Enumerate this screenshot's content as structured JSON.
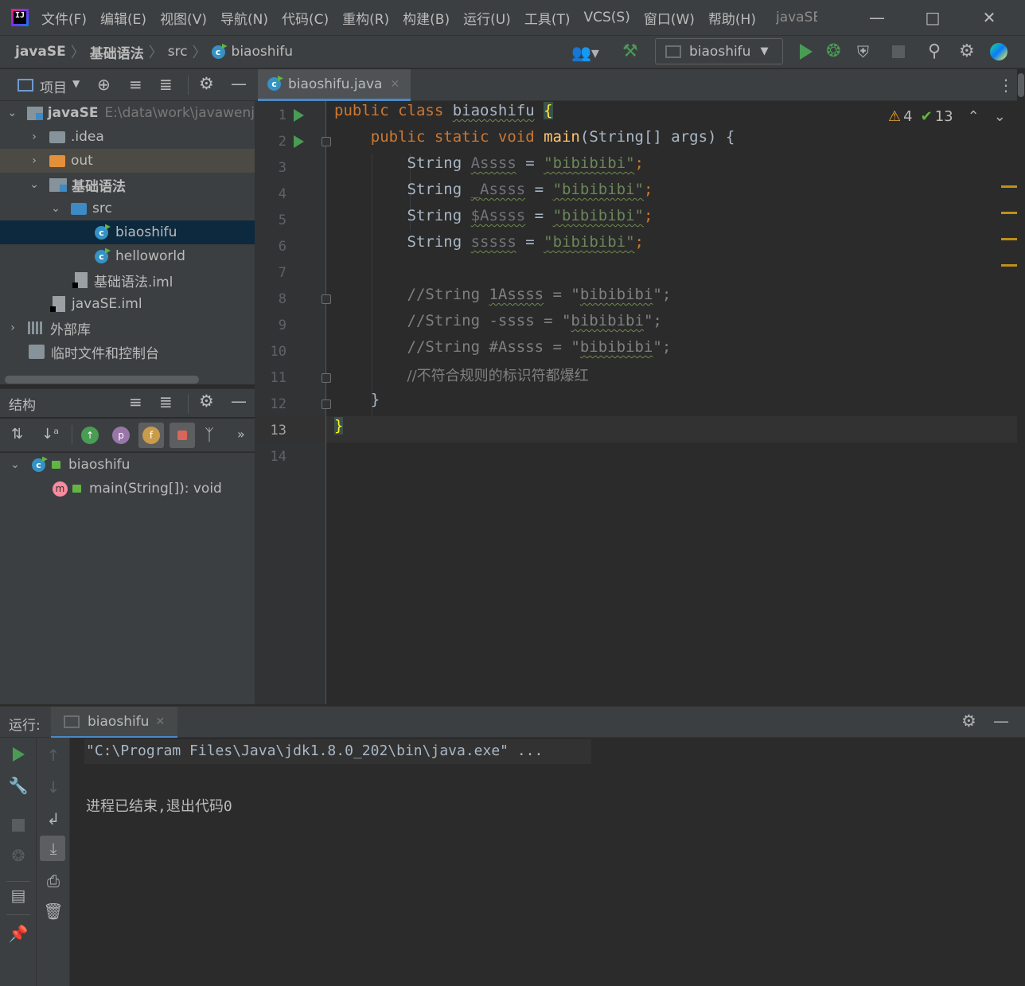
{
  "menu": {
    "items": [
      "文件(F)",
      "编辑(E)",
      "视图(V)",
      "导航(N)",
      "代码(C)",
      "重构(R)",
      "构建(B)",
      "运行(U)",
      "工具(T)",
      "VCS(S)",
      "窗口(W)",
      "帮助(H)"
    ],
    "window_title": "javaSE"
  },
  "breadcrumb": {
    "project": "javaSE",
    "module": "基础语法",
    "folder": "src",
    "file": "biaoshifu"
  },
  "toolbar": {
    "run_config": "biaoshifu"
  },
  "project_panel": {
    "title": "项目",
    "tree": [
      {
        "label": "javaSE",
        "path": "E:\\data\\work\\javawenj"
      },
      {
        "label": ".idea"
      },
      {
        "label": "out"
      },
      {
        "label": "基础语法"
      },
      {
        "label": "src"
      },
      {
        "label": "biaoshifu"
      },
      {
        "label": "helloworld"
      },
      {
        "label": "基础语法.iml"
      },
      {
        "label": "javaSE.iml"
      },
      {
        "label": "外部库"
      },
      {
        "label": "临时文件和控制台"
      }
    ]
  },
  "structure_panel": {
    "title": "结构",
    "class_name": "biaoshifu",
    "method": "main(String[]): void"
  },
  "editor": {
    "tab_label": "biaoshifu.java",
    "warnings": "4",
    "checks": "13",
    "line_numbers": [
      "1",
      "2",
      "3",
      "4",
      "5",
      "6",
      "7",
      "8",
      "9",
      "10",
      "11",
      "12",
      "13",
      "14"
    ],
    "code": {
      "l1_kw": "public class ",
      "l1_name": "biaoshifu",
      "l1_brace": "{",
      "l2_kw": "public static void ",
      "l2_fn": "main",
      "l2_rest": "(String[] args) {",
      "l3_type": "String ",
      "l3_var": "Assss",
      "l3_eq": " = ",
      "l3_str": "\"bibibibi\"",
      "l3_end": ";",
      "l4_type": "String ",
      "l4_var": "_Assss",
      "l4_eq": " = ",
      "l4_str": "\"bibibibi\"",
      "l4_end": ";",
      "l5_type": "String ",
      "l5_var": "$Assss",
      "l5_eq": " = ",
      "l5_str": "\"bibibibi\"",
      "l5_end": ";",
      "l6_type": "String ",
      "l6_var": "sssss",
      "l6_eq": " = ",
      "l6_str": "\"bibibibi\"",
      "l6_end": ";",
      "l8_a": "//String ",
      "l8_b": "1Assss",
      "l8_c": " = \"",
      "l8_d": "bibibibi",
      "l8_e": "\";",
      "l9_a": "//String -ssss = \"",
      "l9_d": "bibibibi",
      "l9_e": "\";",
      "l10_a": "//String #Assss = \"",
      "l10_d": "bibibibi",
      "l10_e": "\";",
      "l11": "//不符合规则的标识符都爆红",
      "l12": "}",
      "l13": "}"
    }
  },
  "run_panel": {
    "label": "运行:",
    "tab_label": "biaoshifu",
    "console": [
      "\"C:\\Program Files\\Java\\jdk1.8.0_202\\bin\\java.exe\" ...",
      "进程已结束,退出代码0"
    ]
  },
  "colors": {
    "keyword": "#cc7832",
    "string": "#6a8759",
    "comment": "#808080",
    "function": "#ffc66d",
    "selection": "#0d293e",
    "accent": "#4a88c7"
  }
}
